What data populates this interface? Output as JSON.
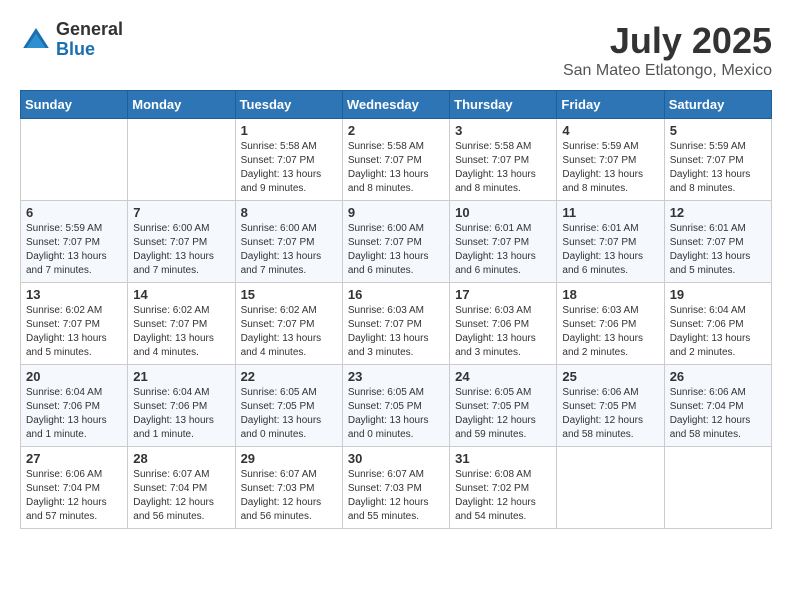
{
  "header": {
    "logo": {
      "general": "General",
      "blue": "Blue"
    },
    "title": "July 2025",
    "location": "San Mateo Etlatongo, Mexico"
  },
  "days_of_week": [
    "Sunday",
    "Monday",
    "Tuesday",
    "Wednesday",
    "Thursday",
    "Friday",
    "Saturday"
  ],
  "weeks": [
    [
      {
        "day": "",
        "info": ""
      },
      {
        "day": "",
        "info": ""
      },
      {
        "day": "1",
        "info": "Sunrise: 5:58 AM\nSunset: 7:07 PM\nDaylight: 13 hours\nand 9 minutes."
      },
      {
        "day": "2",
        "info": "Sunrise: 5:58 AM\nSunset: 7:07 PM\nDaylight: 13 hours\nand 8 minutes."
      },
      {
        "day": "3",
        "info": "Sunrise: 5:58 AM\nSunset: 7:07 PM\nDaylight: 13 hours\nand 8 minutes."
      },
      {
        "day": "4",
        "info": "Sunrise: 5:59 AM\nSunset: 7:07 PM\nDaylight: 13 hours\nand 8 minutes."
      },
      {
        "day": "5",
        "info": "Sunrise: 5:59 AM\nSunset: 7:07 PM\nDaylight: 13 hours\nand 8 minutes."
      }
    ],
    [
      {
        "day": "6",
        "info": "Sunrise: 5:59 AM\nSunset: 7:07 PM\nDaylight: 13 hours\nand 7 minutes."
      },
      {
        "day": "7",
        "info": "Sunrise: 6:00 AM\nSunset: 7:07 PM\nDaylight: 13 hours\nand 7 minutes."
      },
      {
        "day": "8",
        "info": "Sunrise: 6:00 AM\nSunset: 7:07 PM\nDaylight: 13 hours\nand 7 minutes."
      },
      {
        "day": "9",
        "info": "Sunrise: 6:00 AM\nSunset: 7:07 PM\nDaylight: 13 hours\nand 6 minutes."
      },
      {
        "day": "10",
        "info": "Sunrise: 6:01 AM\nSunset: 7:07 PM\nDaylight: 13 hours\nand 6 minutes."
      },
      {
        "day": "11",
        "info": "Sunrise: 6:01 AM\nSunset: 7:07 PM\nDaylight: 13 hours\nand 6 minutes."
      },
      {
        "day": "12",
        "info": "Sunrise: 6:01 AM\nSunset: 7:07 PM\nDaylight: 13 hours\nand 5 minutes."
      }
    ],
    [
      {
        "day": "13",
        "info": "Sunrise: 6:02 AM\nSunset: 7:07 PM\nDaylight: 13 hours\nand 5 minutes."
      },
      {
        "day": "14",
        "info": "Sunrise: 6:02 AM\nSunset: 7:07 PM\nDaylight: 13 hours\nand 4 minutes."
      },
      {
        "day": "15",
        "info": "Sunrise: 6:02 AM\nSunset: 7:07 PM\nDaylight: 13 hours\nand 4 minutes."
      },
      {
        "day": "16",
        "info": "Sunrise: 6:03 AM\nSunset: 7:07 PM\nDaylight: 13 hours\nand 3 minutes."
      },
      {
        "day": "17",
        "info": "Sunrise: 6:03 AM\nSunset: 7:06 PM\nDaylight: 13 hours\nand 3 minutes."
      },
      {
        "day": "18",
        "info": "Sunrise: 6:03 AM\nSunset: 7:06 PM\nDaylight: 13 hours\nand 2 minutes."
      },
      {
        "day": "19",
        "info": "Sunrise: 6:04 AM\nSunset: 7:06 PM\nDaylight: 13 hours\nand 2 minutes."
      }
    ],
    [
      {
        "day": "20",
        "info": "Sunrise: 6:04 AM\nSunset: 7:06 PM\nDaylight: 13 hours\nand 1 minute."
      },
      {
        "day": "21",
        "info": "Sunrise: 6:04 AM\nSunset: 7:06 PM\nDaylight: 13 hours\nand 1 minute."
      },
      {
        "day": "22",
        "info": "Sunrise: 6:05 AM\nSunset: 7:05 PM\nDaylight: 13 hours\nand 0 minutes."
      },
      {
        "day": "23",
        "info": "Sunrise: 6:05 AM\nSunset: 7:05 PM\nDaylight: 13 hours\nand 0 minutes."
      },
      {
        "day": "24",
        "info": "Sunrise: 6:05 AM\nSunset: 7:05 PM\nDaylight: 12 hours\nand 59 minutes."
      },
      {
        "day": "25",
        "info": "Sunrise: 6:06 AM\nSunset: 7:05 PM\nDaylight: 12 hours\nand 58 minutes."
      },
      {
        "day": "26",
        "info": "Sunrise: 6:06 AM\nSunset: 7:04 PM\nDaylight: 12 hours\nand 58 minutes."
      }
    ],
    [
      {
        "day": "27",
        "info": "Sunrise: 6:06 AM\nSunset: 7:04 PM\nDaylight: 12 hours\nand 57 minutes."
      },
      {
        "day": "28",
        "info": "Sunrise: 6:07 AM\nSunset: 7:04 PM\nDaylight: 12 hours\nand 56 minutes."
      },
      {
        "day": "29",
        "info": "Sunrise: 6:07 AM\nSunset: 7:03 PM\nDaylight: 12 hours\nand 56 minutes."
      },
      {
        "day": "30",
        "info": "Sunrise: 6:07 AM\nSunset: 7:03 PM\nDaylight: 12 hours\nand 55 minutes."
      },
      {
        "day": "31",
        "info": "Sunrise: 6:08 AM\nSunset: 7:02 PM\nDaylight: 12 hours\nand 54 minutes."
      },
      {
        "day": "",
        "info": ""
      },
      {
        "day": "",
        "info": ""
      }
    ]
  ]
}
